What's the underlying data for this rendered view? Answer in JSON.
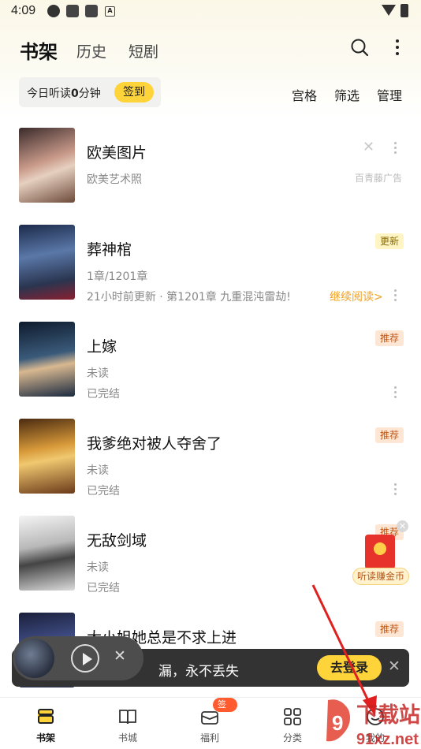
{
  "status_bar": {
    "time": "4:09"
  },
  "header": {
    "tabs": [
      {
        "label": "书架"
      },
      {
        "label": "历史"
      },
      {
        "label": "短剧"
      }
    ]
  },
  "listen": {
    "prefix": "今日听读",
    "minutes": "0",
    "suffix": "分钟",
    "signin_label": "签到"
  },
  "filters": {
    "grid": "宫格",
    "filter": "筛选",
    "manage": "管理"
  },
  "books": [
    {
      "title": "欧美图片",
      "line1": "欧美艺术照",
      "line2": "",
      "tag": "",
      "source": "百青藤广告"
    },
    {
      "title": "葬神棺",
      "line1": "1章/1201章",
      "line2": "21小时前更新 · 第1201章 九重混沌雷劫!",
      "tag": "更新",
      "action": "继续阅读>"
    },
    {
      "title": "上嫁",
      "line1": "未读",
      "line2": "已完结",
      "tag": "推荐"
    },
    {
      "title": "我爹绝对被人夺舍了",
      "line1": "未读",
      "line2": "已完结",
      "tag": "推荐"
    },
    {
      "title": "无敌剑域",
      "line1": "未读",
      "line2": "已完结",
      "tag": "推荐"
    },
    {
      "title": "大小姐她总是不求上进",
      "line1": "",
      "line2": "",
      "tag": "推荐"
    }
  ],
  "coin_ad": {
    "label": "听读赚金币"
  },
  "login_banner": {
    "text": "漏，永不丢失",
    "button": "去登录"
  },
  "bottom_nav": [
    {
      "label": "书架",
      "icon": "bookshelf-icon",
      "active": true
    },
    {
      "label": "书城",
      "icon": "book-icon"
    },
    {
      "label": "福利",
      "icon": "gift-icon",
      "badge": "签到"
    },
    {
      "label": "分类",
      "icon": "category-icon"
    },
    {
      "label": "我的",
      "icon": "profile-icon"
    }
  ],
  "watermark": {
    "text": "下载站",
    "site": "91xz.net"
  },
  "colors": {
    "accent": "#ffd43b",
    "tag_new_bg": "#fff5c4",
    "tag_rec_bg": "#fde6d4",
    "continue": "#f0a020"
  }
}
